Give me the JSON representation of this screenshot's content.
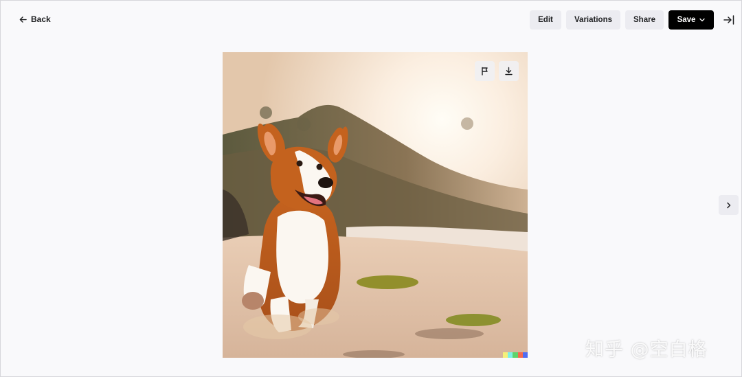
{
  "header": {
    "back_label": "Back",
    "edit_label": "Edit",
    "variations_label": "Variations",
    "share_label": "Share",
    "save_label": "Save"
  },
  "icons": {
    "back": "arrow-left-icon",
    "save_menu": "chevron-down-icon",
    "collapse": "collapse-panel-icon",
    "flag": "flag-icon",
    "download": "download-icon",
    "next": "chevron-right-icon"
  },
  "colors": {
    "save_bg": "#000000",
    "button_bg": "#ececf1",
    "signature": [
      "#f5f07a",
      "#7ef0e6",
      "#5fd36b",
      "#f26a4f",
      "#4f6df2"
    ]
  },
  "watermark": "知乎 @空白格"
}
